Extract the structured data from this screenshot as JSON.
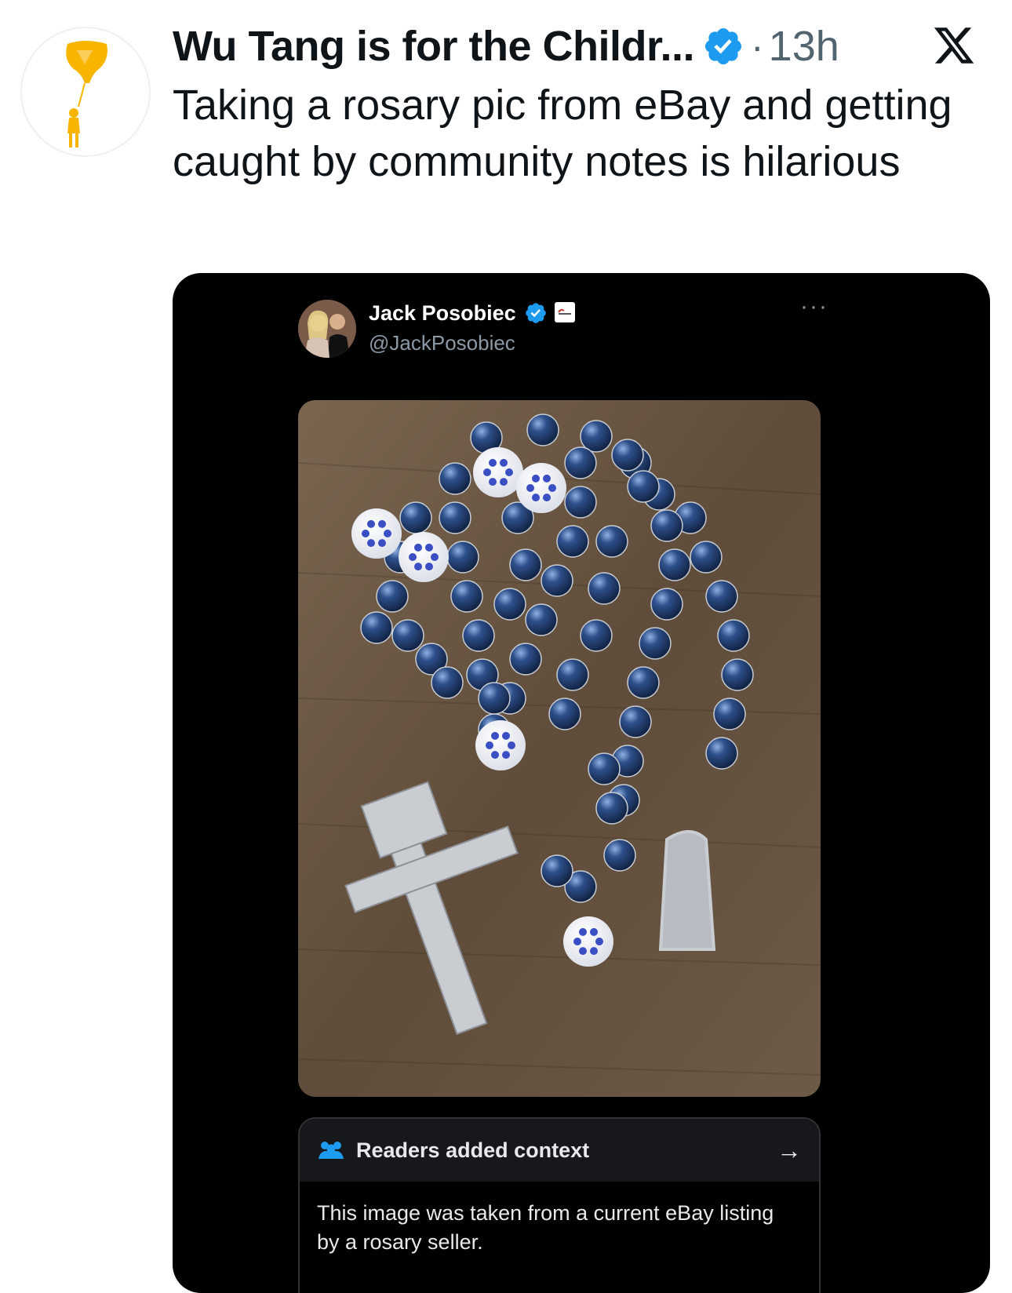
{
  "tweet": {
    "author_name": "Wu Tang is for the Childr...",
    "separator": "·",
    "timestamp": "13h",
    "text": "Taking a rosary pic from eBay and getting caught by community notes is hilarious"
  },
  "quoted_post": {
    "author_name": "Jack Posobiec",
    "author_handle": "@JackPosobiec",
    "more_label": "···",
    "community_note": {
      "title": "Readers added context",
      "body": "This image was taken from a current eBay listing by a rosary seller."
    }
  },
  "colors": {
    "verified": "#1d9bf0",
    "wu_tang_yellow": "#f7b500",
    "navy_bead": "#1c3a6b"
  },
  "icons": [
    "verified-badge-icon",
    "x-logo-icon",
    "people-icon",
    "arrow-right-icon",
    "more-icon"
  ]
}
